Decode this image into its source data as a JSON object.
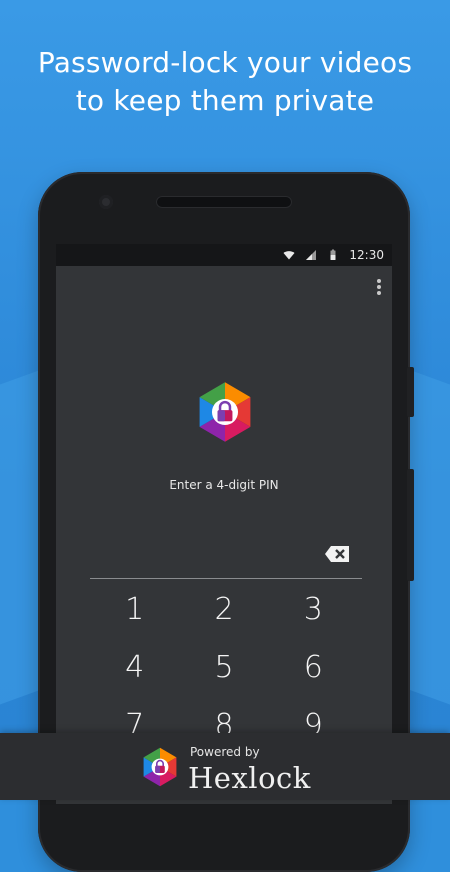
{
  "headline": {
    "line1": "Password-lock your videos",
    "line2": "to keep them private"
  },
  "status_bar": {
    "time": "12:30",
    "icons": [
      "wifi-icon",
      "signal-icon",
      "battery-icon"
    ]
  },
  "app": {
    "menu_icon": "overflow-menu-icon",
    "logo_icon": "hexlock-logo-icon",
    "pin_prompt": "Enter a 4-digit PIN",
    "backspace_icon": "backspace-icon",
    "keypad": [
      "1",
      "2",
      "3",
      "4",
      "5",
      "6",
      "7",
      "8",
      "9"
    ]
  },
  "footer": {
    "powered_by": "Powered by",
    "brand": "Hexlock",
    "logo_icon": "hexlock-logo-icon"
  },
  "colors": {
    "background_blue": "#2f8fdc",
    "screen_bg": "#333538",
    "status_bar_bg": "#151618",
    "footer_bg": "#2c2d30",
    "hex_red": "#e53935",
    "hex_orange": "#fb8c00",
    "hex_green": "#43a047",
    "hex_blue": "#1e88e5",
    "hex_purple": "#8e24aa",
    "hex_magenta": "#d81b60"
  }
}
